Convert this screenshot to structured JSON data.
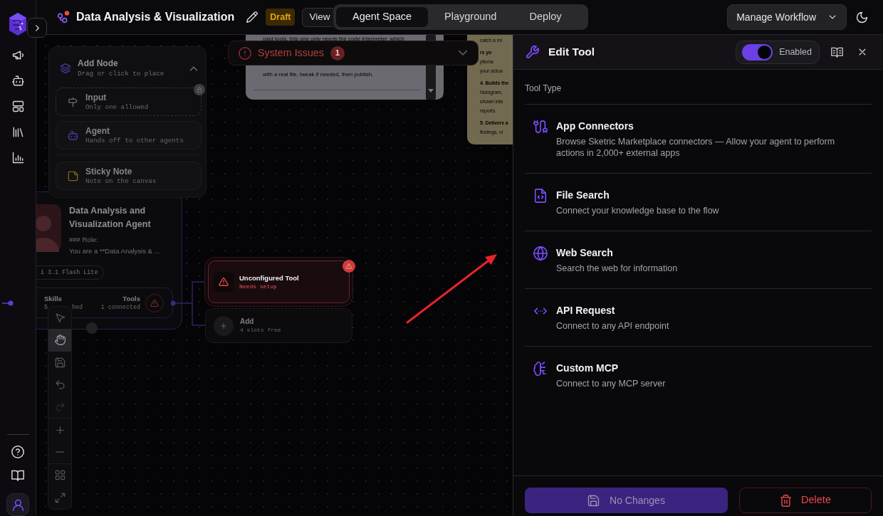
{
  "header": {
    "title": "Data Analysis & Visualization",
    "status": "Draft",
    "view_button": "View",
    "tabs": [
      {
        "label": "Agent Space",
        "selected": true
      },
      {
        "label": "Playground",
        "selected": false
      },
      {
        "label": "Deploy",
        "selected": false
      }
    ],
    "manage_button": "Manage Workflow"
  },
  "canvas": {
    "add_node_panel": {
      "title": "Add Node",
      "subtitle": "Drag or click to place",
      "expanded": true,
      "items": [
        {
          "kind": "input",
          "title": "Input",
          "subtitle": "Only one allowed",
          "locked": true
        },
        {
          "kind": "agent",
          "title": "Agent",
          "subtitle": "Hands off to other agents",
          "locked": false
        },
        {
          "kind": "sticky",
          "title": "Sticky Note",
          "subtitle": "Note on the canvas",
          "locked": false
        }
      ]
    },
    "system_issues": {
      "label": "System Issues",
      "count": "1",
      "expanded": false
    },
    "sticky_notes": [
      {
        "color": "#6a6a70",
        "lines": [
          {
            "text": "paid tools, this one only needs the code interpreter, which",
            "bold": false
          },
          {
            "text": "with a real file, tweak if needed, then publish.",
            "bold": false
          }
        ]
      },
      {
        "color": "#716a50",
        "lines": [
          {
            "text": "catch a mi",
            "bold": false
          },
          {
            "text": "rs yo",
            "bold": true
          },
          {
            "text": "ptiona",
            "bold": false
          },
          {
            "text": "your actua",
            "bold": false
          },
          {
            "text": "4. Builds the",
            "bold": true
          },
          {
            "text": "histogram,",
            "bold": false
          },
          {
            "text": "shown inte",
            "bold": false
          },
          {
            "text": "reports.",
            "bold": false
          },
          {
            "text": "5. Delivers a",
            "bold": true
          },
          {
            "text": "findings, vi",
            "bold": false
          }
        ]
      }
    ],
    "agent_node": {
      "name": "Data Analysis and Visualization Agent",
      "role_heading": "### Role:",
      "prompt_preview": "You are a **Data Analysis & ...",
      "model": "i 3.1 Flash Lite",
      "skills_label": "Skills",
      "skills_status": [
        "5",
        "hed"
      ],
      "tools_label": "Tools",
      "tools_status": "1 connected",
      "tools_warning": true
    },
    "tool_nodes": [
      {
        "kind": "unconfigured",
        "title": "Unconfigured Tool",
        "subtitle": "Needs setup"
      },
      {
        "kind": "add",
        "title": "Add",
        "subtitle": "4 slots free"
      }
    ],
    "toolbar": {
      "modes": [
        {
          "kind": "select",
          "selected": false
        },
        {
          "kind": "pan",
          "selected": true
        }
      ],
      "redo_disabled": true
    }
  },
  "edit_panel": {
    "title": "Edit Tool",
    "enabled": true,
    "enabled_label": "Enabled",
    "section_label": "Tool Type",
    "tool_types": [
      {
        "kind": "app_connectors",
        "title": "App Connectors",
        "description": "Browse Sketric Marketplace connectors — Allow your agent to perform actions in 2,000+ external apps"
      },
      {
        "kind": "file_search",
        "title": "File Search",
        "description": "Connect your knowledge base to the flow"
      },
      {
        "kind": "web_search",
        "title": "Web Search",
        "description": "Search the web for information"
      },
      {
        "kind": "api_request",
        "title": "API Request",
        "description": "Connect to any API endpoint"
      },
      {
        "kind": "custom_mcp",
        "title": "Custom MCP",
        "description": "Connect to any MCP server"
      }
    ],
    "save_button": "No Changes",
    "save_disabled": true,
    "delete_button": "Delete"
  }
}
